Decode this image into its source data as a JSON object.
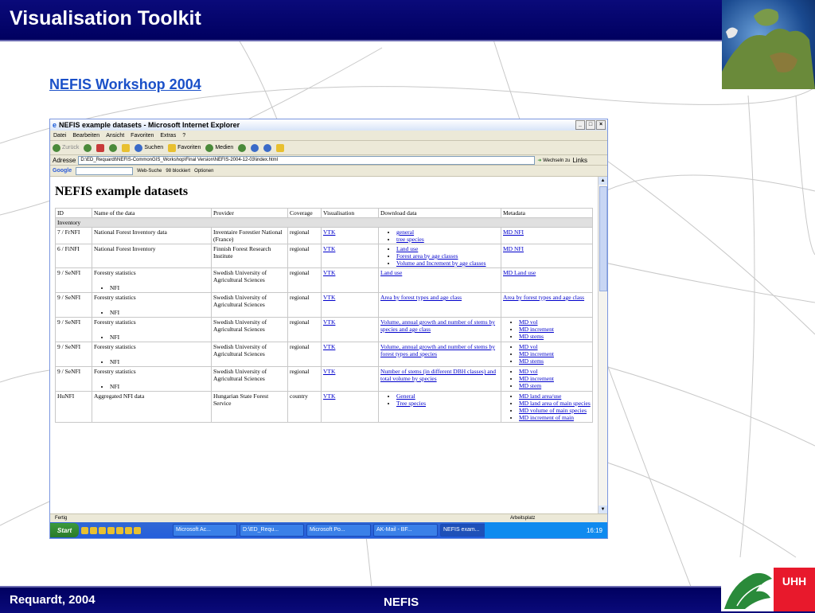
{
  "slide": {
    "title": "Visualisation Toolkit",
    "subtitle": "NEFIS Workshop 2004",
    "author": "Requardt, 2004",
    "footer": "NEFIS",
    "logo_text": "UHH"
  },
  "browser": {
    "window_title": "NEFIS example datasets - Microsoft Internet Explorer",
    "menu": [
      "Datei",
      "Bearbeiten",
      "Ansicht",
      "Favoriten",
      "Extras",
      "?"
    ],
    "toolbar": {
      "back": "Zurück",
      "search": "Suchen",
      "favorites": "Favoriten",
      "media": "Medien"
    },
    "address_label": "Adresse",
    "address_value": "D:\\ED_Requardt\\NEFIS-CommonGIS_Workshop\\Final Version\\NEFIS-2004-12-03\\index.html",
    "go_label": "Wechseln zu",
    "links_label": "Links",
    "google": {
      "label": "Google",
      "web_search": "Web-Suche",
      "blocked": "98 blockiert",
      "options": "Optionen"
    },
    "status_left": "Fertig",
    "status_right": "Arbeitsplatz"
  },
  "page": {
    "heading": "NEFIS example datasets",
    "columns": [
      "ID",
      "Name of the data",
      "Provider",
      "Coverage",
      "Visualisation",
      "Download data",
      "Metadata"
    ],
    "section": "Inventory",
    "rows": [
      {
        "id": "7 / FrNFI",
        "name": "National Forest Inventory data",
        "name_items": [],
        "provider": "Inventaire Forestier National (France)",
        "coverage": "regional",
        "vis": "VTK",
        "download": [
          "general",
          "tree species"
        ],
        "download_list": true,
        "metadata": [
          "MD NFI"
        ],
        "metadata_list": false
      },
      {
        "id": "6 / FiNFI",
        "name": "National Forest Inventory",
        "name_items": [],
        "provider": "Finnish Forest Research Institute",
        "coverage": "regional",
        "vis": "VTK",
        "download": [
          "Land use",
          "Forest area by age classes",
          "Volume and Increment by age classes"
        ],
        "download_list": true,
        "metadata": [
          "MD NFI"
        ],
        "metadata_list": false
      },
      {
        "id": "9 / SeNFI",
        "name": "Forestry statistics",
        "name_items": [
          "NFI"
        ],
        "provider": "Swedish University of Agricultural Sciences",
        "coverage": "regional",
        "vis": "VTK",
        "download": [
          "Land use"
        ],
        "download_list": false,
        "metadata": [
          "MD Land use"
        ],
        "metadata_list": false
      },
      {
        "id": "9 / SeNFI",
        "name": "Forestry statistics",
        "name_items": [
          "NFI"
        ],
        "provider": "Swedish University of Agricultural Sciences",
        "coverage": "regional",
        "vis": "VTK",
        "download": [
          "Area by forest types and age class"
        ],
        "download_list": false,
        "metadata": [
          "Area by forest types and age class"
        ],
        "metadata_list": false
      },
      {
        "id": "9 / SeNFI",
        "name": "Forestry statistics",
        "name_items": [
          "NFI"
        ],
        "provider": "Swedish University of Agricultural Sciences",
        "coverage": "regional",
        "vis": "VTK",
        "download": [
          "Volume, annual growth and number of stems by species and age class"
        ],
        "download_list": false,
        "metadata": [
          "MD vol",
          "MD increment",
          "MD stems"
        ],
        "metadata_list": true
      },
      {
        "id": "9 / SeNFI",
        "name": "Forestry statistics",
        "name_items": [
          "NFI"
        ],
        "provider": "Swedish University of Agricultural Sciences",
        "coverage": "regional",
        "vis": "VTK",
        "download": [
          "Volume, annual growth and number of stems by forest types and species"
        ],
        "download_list": false,
        "metadata": [
          "MD vol",
          "MD increment",
          "MD stems"
        ],
        "metadata_list": true
      },
      {
        "id": "9 / SeNFI",
        "name": "Forestry statistics",
        "name_items": [
          "NFI"
        ],
        "provider": "Swedish University of Agricultural Sciences",
        "coverage": "regional",
        "vis": "VTK",
        "download": [
          "Number of stems (in different DBH classes) and total volume by species"
        ],
        "download_list": false,
        "metadata": [
          "MD vol",
          "MD increment",
          "MD stem"
        ],
        "metadata_list": true
      },
      {
        "id": "HuNFI",
        "name": "Aggregated NFI data",
        "name_items": [],
        "provider": "Hungarian State Forest Service",
        "coverage": "country",
        "vis": "VTK",
        "download": [
          "General",
          "Tree species"
        ],
        "download_list": true,
        "metadata": [
          "MD land area/use",
          "MD land area of main species",
          "MD volume of main species",
          "MD increment of main"
        ],
        "metadata_list": true
      }
    ]
  },
  "taskbar": {
    "start": "Start",
    "tasks": [
      "Microsoft Ac...",
      "D:\\ED_Requ...",
      "Microsoft Po...",
      "AK-Mail - BF...",
      "NEFIS exam..."
    ],
    "active_index": 4,
    "clock": "16:19"
  }
}
